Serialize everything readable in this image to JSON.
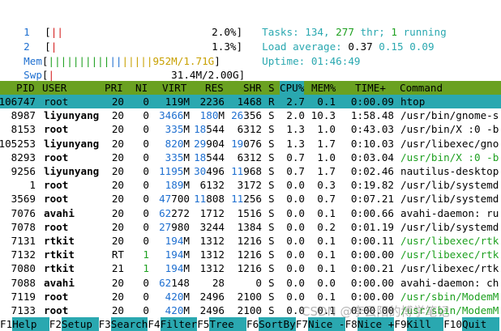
{
  "meters": {
    "cpu1": {
      "label": "1",
      "bar": "||",
      "value": "2.0%"
    },
    "cpu2": {
      "label": "2",
      "bar": "|",
      "value": "1.3%"
    },
    "mem": {
      "label": "Mem",
      "bar": "|||||||||||||||||",
      "value": "952M/1.71G"
    },
    "swp": {
      "label": "Swp",
      "value": "31.4M/2.00G"
    }
  },
  "info": {
    "tasks_label": "Tasks: ",
    "tasks": "134",
    "comma": ", ",
    "thr": "277",
    "thr_label": " thr; ",
    "running": "1",
    "running_label": " running",
    "load_label": "Load average: ",
    "load1": "0.37",
    "load5": "0.15",
    "load15": "0.09",
    "uptime_label": "Uptime: ",
    "uptime": "01:46:49"
  },
  "columns": [
    "PID",
    "USER",
    "PRI",
    "NI",
    "VIRT",
    "RES",
    "SHR",
    "S",
    "CPU%",
    "MEM%",
    "TIME+",
    "Command"
  ],
  "processes": [
    {
      "pid": "106747",
      "user": "root",
      "pri": "20",
      "ni": "0",
      "virt": "119M",
      "res": "2236",
      "shr": "1468",
      "s": "R",
      "cpu": "2.7",
      "mem": "0.1",
      "time": "0:00.09",
      "cmd": "htop",
      "selected": true,
      "thread": false
    },
    {
      "pid": "8987",
      "user": "liyunyang",
      "pri": "20",
      "ni": "0",
      "virt": "3466M",
      "res": "180M",
      "shr": "26356",
      "s": "S",
      "cpu": "2.0",
      "mem": "10.3",
      "time": "1:58.48",
      "cmd": "/usr/bin/gnome-s",
      "selected": false,
      "thread": false
    },
    {
      "pid": "8153",
      "user": "root",
      "pri": "20",
      "ni": "0",
      "virt": "335M",
      "res": "18544",
      "shr": "6312",
      "s": "S",
      "cpu": "1.3",
      "mem": "1.0",
      "time": "0:43.03",
      "cmd": "/usr/bin/X :0 -b",
      "selected": false,
      "thread": false
    },
    {
      "pid": "105253",
      "user": "liyunyang",
      "pri": "20",
      "ni": "0",
      "virt": "820M",
      "res": "29904",
      "shr": "19076",
      "s": "S",
      "cpu": "1.3",
      "mem": "1.7",
      "time": "0:10.03",
      "cmd": "/usr/libexec/gno",
      "selected": false,
      "thread": false
    },
    {
      "pid": "8293",
      "user": "root",
      "pri": "20",
      "ni": "0",
      "virt": "335M",
      "res": "18544",
      "shr": "6312",
      "s": "S",
      "cpu": "0.7",
      "mem": "1.0",
      "time": "0:03.04",
      "cmd": "/usr/bin/X :0 -b",
      "selected": false,
      "thread": true
    },
    {
      "pid": "9256",
      "user": "liyunyang",
      "pri": "20",
      "ni": "0",
      "virt": "1195M",
      "res": "30496",
      "shr": "11968",
      "s": "S",
      "cpu": "0.7",
      "mem": "1.7",
      "time": "0:02.46",
      "cmd": "nautilus-desktop",
      "selected": false,
      "thread": false
    },
    {
      "pid": "1",
      "user": "root",
      "pri": "20",
      "ni": "0",
      "virt": "189M",
      "res": "6132",
      "shr": "3172",
      "s": "S",
      "cpu": "0.0",
      "mem": "0.3",
      "time": "0:19.82",
      "cmd": "/usr/lib/systemd",
      "selected": false,
      "thread": false
    },
    {
      "pid": "3569",
      "user": "root",
      "pri": "20",
      "ni": "0",
      "virt": "47700",
      "res": "11808",
      "shr": "11256",
      "s": "S",
      "cpu": "0.0",
      "mem": "0.7",
      "time": "0:07.21",
      "cmd": "/usr/lib/systemd",
      "selected": false,
      "thread": false
    },
    {
      "pid": "7076",
      "user": "avahi",
      "pri": "20",
      "ni": "0",
      "virt": "62272",
      "res": "1712",
      "shr": "1516",
      "s": "S",
      "cpu": "0.0",
      "mem": "0.1",
      "time": "0:00.66",
      "cmd": "avahi-daemon: ru",
      "selected": false,
      "thread": false
    },
    {
      "pid": "7078",
      "user": "root",
      "pri": "20",
      "ni": "0",
      "virt": "27980",
      "res": "3244",
      "shr": "1384",
      "s": "S",
      "cpu": "0.0",
      "mem": "0.2",
      "time": "0:01.19",
      "cmd": "/usr/lib/systemd",
      "selected": false,
      "thread": false
    },
    {
      "pid": "7131",
      "user": "rtkit",
      "pri": "20",
      "ni": "0",
      "virt": "194M",
      "res": "1312",
      "shr": "1216",
      "s": "S",
      "cpu": "0.0",
      "mem": "0.1",
      "time": "0:00.11",
      "cmd": "/usr/libexec/rtk",
      "selected": false,
      "thread": true
    },
    {
      "pid": "7132",
      "user": "rtkit",
      "pri": "RT",
      "ni": "1",
      "virt": "194M",
      "res": "1312",
      "shr": "1216",
      "s": "S",
      "cpu": "0.0",
      "mem": "0.1",
      "time": "0:00.00",
      "cmd": "/usr/libexec/rtk",
      "selected": false,
      "thread": true
    },
    {
      "pid": "7080",
      "user": "rtkit",
      "pri": "21",
      "ni": "1",
      "virt": "194M",
      "res": "1312",
      "shr": "1216",
      "s": "S",
      "cpu": "0.0",
      "mem": "0.1",
      "time": "0:00.21",
      "cmd": "/usr/libexec/rtk",
      "selected": false,
      "thread": false
    },
    {
      "pid": "7088",
      "user": "avahi",
      "pri": "20",
      "ni": "0",
      "virt": "62148",
      "res": "28",
      "shr": "0",
      "s": "S",
      "cpu": "0.0",
      "mem": "0.0",
      "time": "0:00.00",
      "cmd": "avahi-daemon: ch",
      "selected": false,
      "thread": false
    },
    {
      "pid": "7119",
      "user": "root",
      "pri": "20",
      "ni": "0",
      "virt": "420M",
      "res": "2496",
      "shr": "2100",
      "s": "S",
      "cpu": "0.0",
      "mem": "0.1",
      "time": "0:00.00",
      "cmd": "/usr/sbin/ModemM",
      "selected": false,
      "thread": true
    },
    {
      "pid": "7133",
      "user": "root",
      "pri": "20",
      "ni": "0",
      "virt": "420M",
      "res": "2496",
      "shr": "2100",
      "s": "S",
      "cpu": "0.0",
      "mem": "0.1",
      "time": "0:00.00",
      "cmd": "/usr/sbin/ModemM",
      "selected": false,
      "thread": true
    }
  ],
  "footer": [
    {
      "key": "F1",
      "label": "Help"
    },
    {
      "key": "F2",
      "label": "Setup"
    },
    {
      "key": "F3",
      "label": "Search"
    },
    {
      "key": "F4",
      "label": "Filter"
    },
    {
      "key": "F5",
      "label": "Tree"
    },
    {
      "key": "F6",
      "label": "SortBy"
    },
    {
      "key": "F7",
      "label": "Nice -"
    },
    {
      "key": "F8",
      "label": "Nice +"
    },
    {
      "key": "F9",
      "label": "Kill"
    },
    {
      "key": "F10",
      "label": "Quit"
    }
  ],
  "watermark": "CSDN @李云阳的博学笔记",
  "colors": {
    "header_bg": "#6aa121",
    "selected_bg": "#2aa8b0",
    "label_blue": "#1e6fd0",
    "thread_green": "#1ea020"
  }
}
